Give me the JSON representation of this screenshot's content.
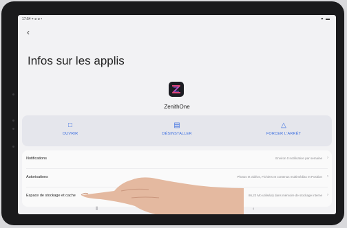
{
  "status_bar": {
    "time": "17:54 ⌖ ⊘ ⊘ ▪",
    "signals": "▾ ▬"
  },
  "header": {
    "back_icon": "back-arrow-icon",
    "title": "Infos sur les applis"
  },
  "app": {
    "name": "ZenithOne",
    "icon": "zenithone-app-icon"
  },
  "actions": [
    {
      "label": "OUVRIR",
      "icon": "open-icon",
      "glyph": "⧉"
    },
    {
      "label": "DÉSINSTALLER",
      "icon": "trash-icon",
      "glyph": "🗑"
    },
    {
      "label": "FORCER L'ARRÊT",
      "icon": "warning-icon",
      "glyph": "⚠"
    }
  ],
  "settings_rows": [
    {
      "label": "Notifications",
      "value": "Environ 0 notification par semaine"
    },
    {
      "label": "Autorisations",
      "value": "Photos et vidéos, Fichiers et contenus multimédias et Position"
    },
    {
      "label": "Espace de stockage et cache",
      "value": "86,22 Mo utilisé(s) dans mémoire de stockage interne"
    }
  ],
  "nav_bar": {
    "recents": "⦀",
    "home": "▢",
    "back": "‹"
  },
  "accent_color": "#3d6fe0"
}
